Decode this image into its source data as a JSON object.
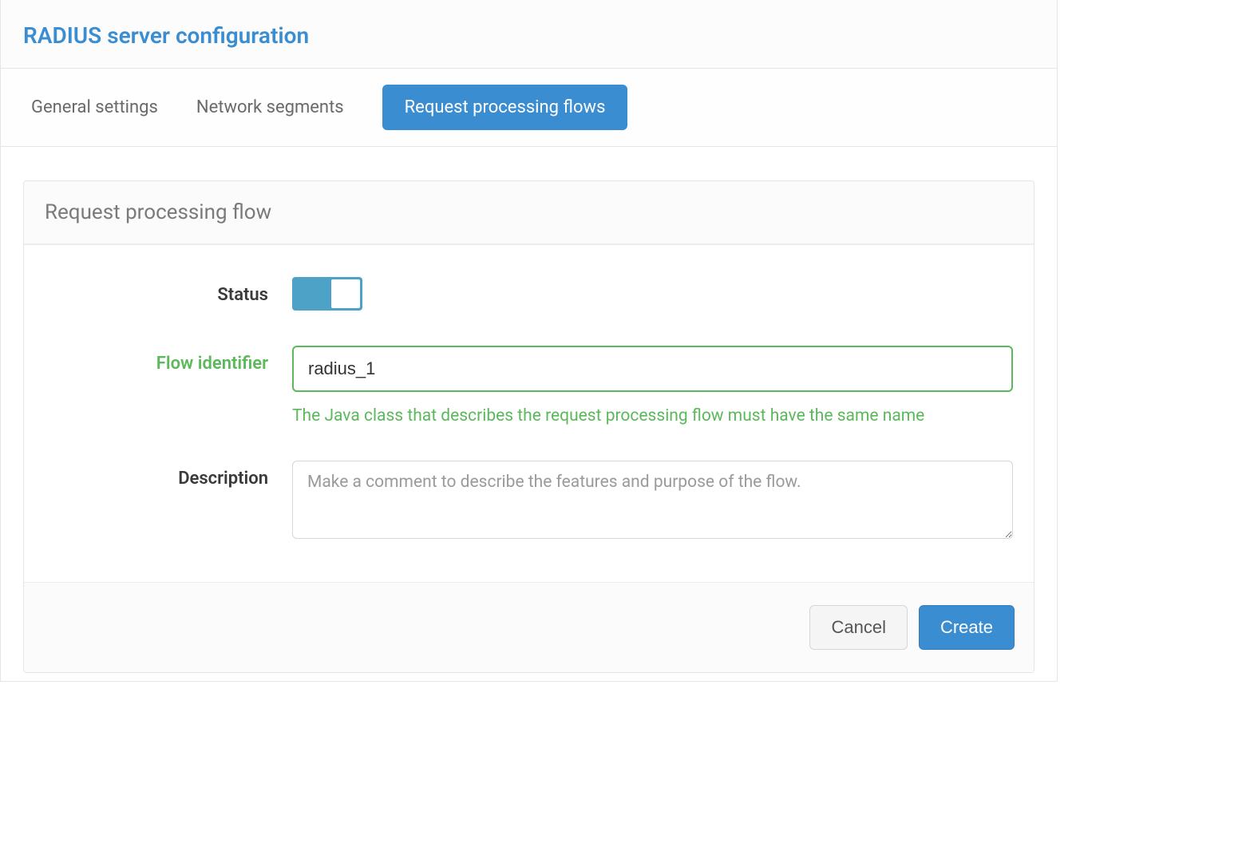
{
  "header": {
    "title": "RADIUS server configuration"
  },
  "tabs": [
    {
      "label": "General settings",
      "active": false
    },
    {
      "label": "Network segments",
      "active": false
    },
    {
      "label": "Request processing flows",
      "active": true
    }
  ],
  "panel": {
    "title": "Request processing flow",
    "form": {
      "status": {
        "label": "Status",
        "value": true
      },
      "flow_identifier": {
        "label": "Flow identifier",
        "value": "radius_1",
        "help": "The Java class that describes the request processing flow must have the same name"
      },
      "description": {
        "label": "Description",
        "value": "",
        "placeholder": "Make a comment to describe the features and purpose of the flow."
      }
    },
    "buttons": {
      "cancel": "Cancel",
      "create": "Create"
    }
  },
  "colors": {
    "accent": "#3a8dd1",
    "success": "#5bb85b",
    "toggle": "#4da3c7"
  }
}
